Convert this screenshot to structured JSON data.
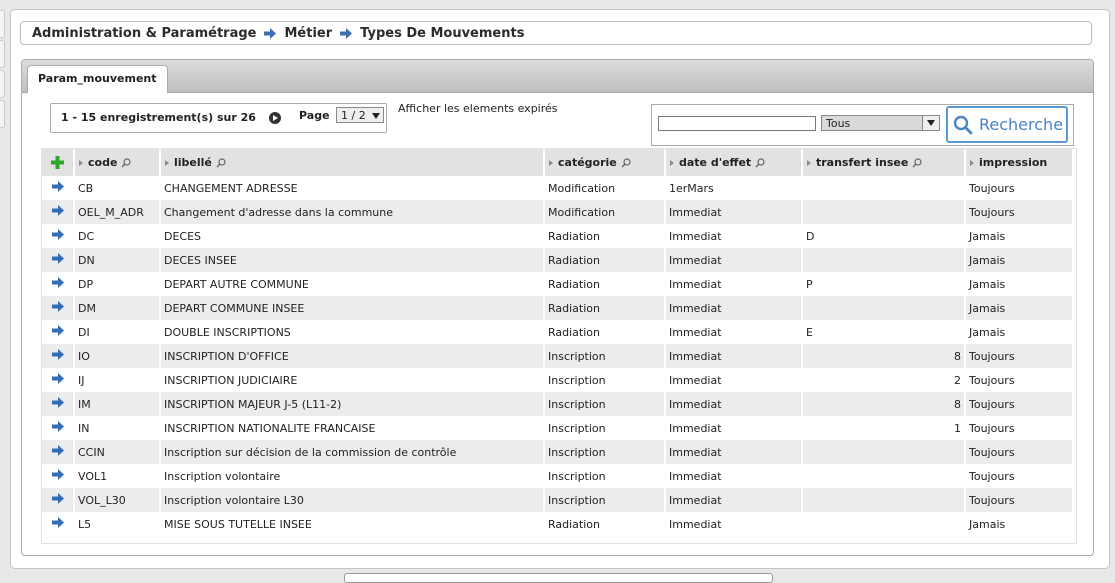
{
  "breadcrumb": {
    "items": [
      "Administration & Paramétrage",
      "Métier",
      "Types De Mouvements"
    ]
  },
  "tab": {
    "label": "Param_mouvement"
  },
  "pager": {
    "count_text": "1 - 15 enregistrement(s) sur 26",
    "page_label": "Page",
    "page_value": "1 / 2"
  },
  "expired_link": "Afficher les elements expirés",
  "search": {
    "input_value": "",
    "select_value": "Tous",
    "button_label": "Recherche"
  },
  "colors": {
    "accent": "#4a84c4",
    "add": "#2fa52f",
    "row_arrow": "#2f6fb5"
  },
  "table": {
    "columns": [
      "code",
      "libellé",
      "catégorie",
      "date d'effet",
      "transfert insee",
      "impression"
    ],
    "rows": [
      [
        "CB",
        "CHANGEMENT ADRESSE",
        "Modification",
        "1erMars",
        "",
        "Toujours"
      ],
      [
        "OEL_M_ADR",
        "Changement d'adresse dans la commune",
        "Modification",
        "Immediat",
        "",
        "Toujours"
      ],
      [
        "DC",
        "DECES",
        "Radiation",
        "Immediat",
        "D",
        "Jamais"
      ],
      [
        "DN",
        "DECES INSEE",
        "Radiation",
        "Immediat",
        "",
        "Jamais"
      ],
      [
        "DP",
        "DEPART AUTRE COMMUNE",
        "Radiation",
        "Immediat",
        "P",
        "Jamais"
      ],
      [
        "DM",
        "DEPART COMMUNE INSEE",
        "Radiation",
        "Immediat",
        "",
        "Jamais"
      ],
      [
        "DI",
        "DOUBLE INSCRIPTIONS",
        "Radiation",
        "Immediat",
        "E",
        "Jamais"
      ],
      [
        "IO",
        "INSCRIPTION D'OFFICE",
        "Inscription",
        "Immediat",
        "8",
        "Toujours"
      ],
      [
        "IJ",
        "INSCRIPTION JUDICIAIRE",
        "Inscription",
        "Immediat",
        "2",
        "Toujours"
      ],
      [
        "IM",
        "INSCRIPTION MAJEUR J-5 (L11-2)",
        "Inscription",
        "Immediat",
        "8",
        "Toujours"
      ],
      [
        "IN",
        "INSCRIPTION NATIONALITE FRANCAISE",
        "Inscription",
        "Immediat",
        "1",
        "Toujours"
      ],
      [
        "CCIN",
        "Inscription sur décision de la commission de contrôle",
        "Inscription",
        "Immediat",
        "",
        "Toujours"
      ],
      [
        "VOL1",
        "Inscription volontaire",
        "Inscription",
        "Immediat",
        "",
        "Toujours"
      ],
      [
        "VOL_L30",
        "Inscription volontaire L30",
        "Inscription",
        "Immediat",
        "",
        "Toujours"
      ],
      [
        "L5",
        "MISE SOUS TUTELLE INSEE",
        "Radiation",
        "Immediat",
        "",
        "Jamais"
      ]
    ]
  }
}
